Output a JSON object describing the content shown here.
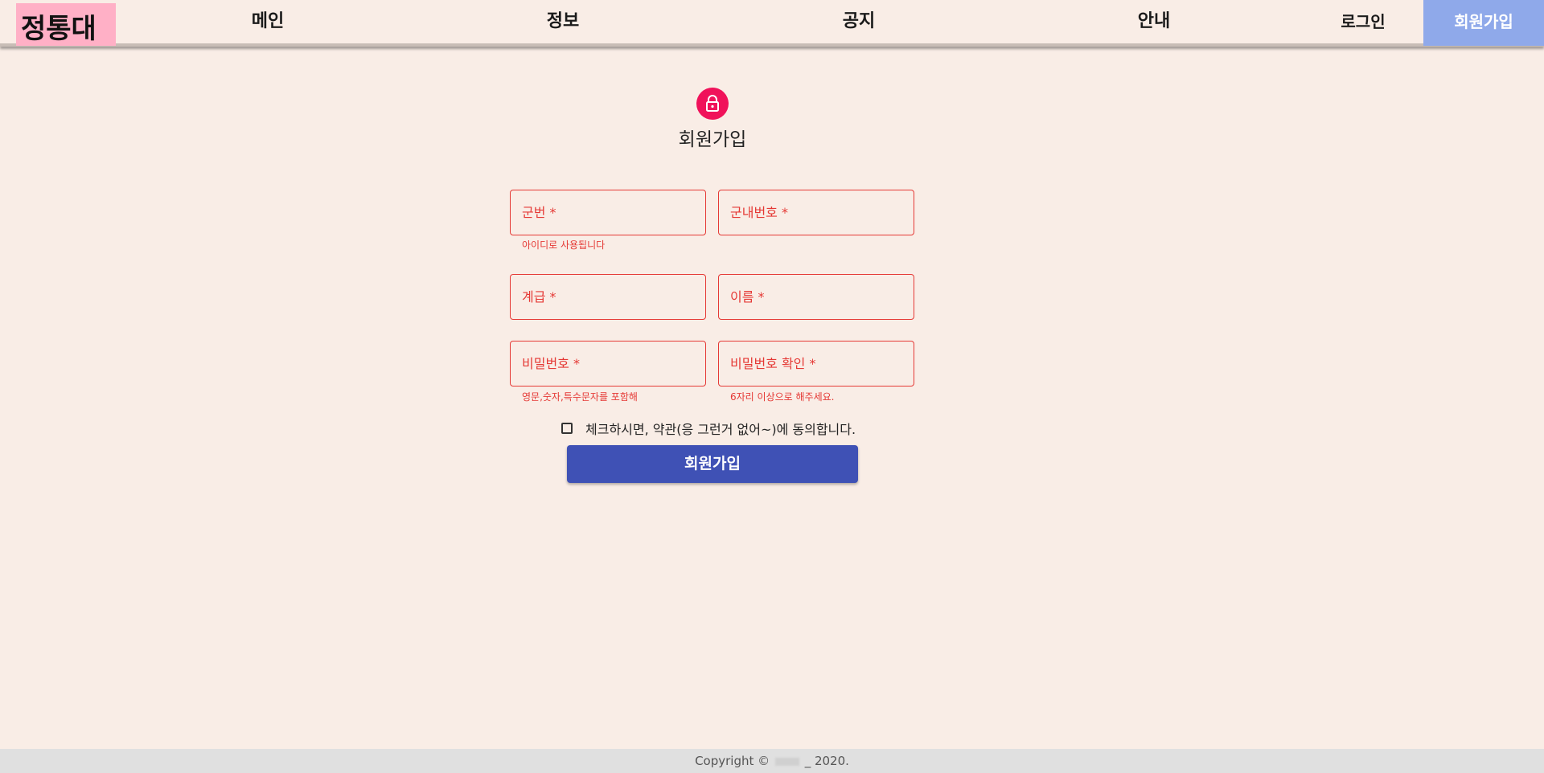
{
  "header": {
    "logo": "정통대",
    "nav": {
      "main": "메인",
      "info": "정보",
      "notice": "공지",
      "guide": "안내",
      "login": "로그인",
      "signup": "회원가입"
    },
    "signup_highlight_color": "#8fa9ea",
    "logo_color": "#ffb0c6"
  },
  "form": {
    "icon": "lock-icon",
    "title": "회원가입",
    "fields": {
      "serial": {
        "label": "군번 *",
        "helper": "아이디로 사용됩니다"
      },
      "phone": {
        "label": "군내번호 *"
      },
      "rank": {
        "label": "계급 *"
      },
      "name": {
        "label": "이름 *"
      },
      "password": {
        "label": "비밀번호 *",
        "helper": "영문,숫자,특수문자를 포함해"
      },
      "password_confirm": {
        "label": "비밀번호 확인 *",
        "helper": "6자리 이상으로 해주세요."
      }
    },
    "agree_text": "체크하시면, 약관(응 그런거 없어~)에 동의합니다.",
    "submit_label": "회원가입",
    "error_color": "#e53935",
    "button_color": "#3f51b5"
  },
  "footer": {
    "copyright_prefix": "Copyright ©",
    "copyright_suffix": "_ 2020."
  }
}
